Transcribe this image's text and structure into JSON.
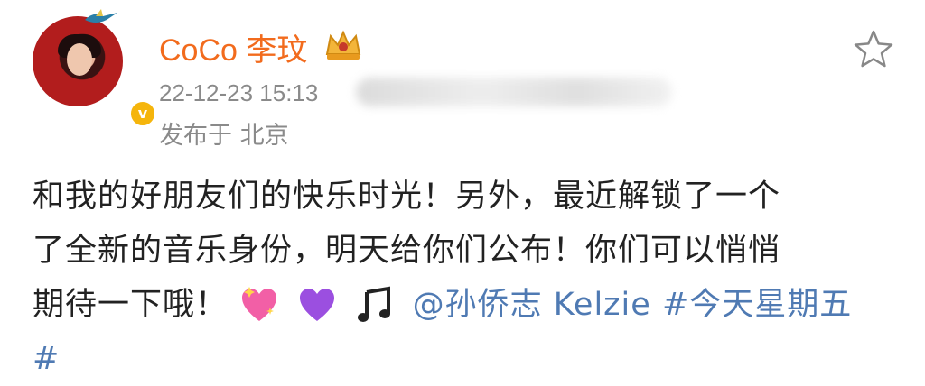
{
  "post": {
    "user_name": "CoCo 李玟",
    "timestamp": "22-12-23 15:13",
    "location": "发布于 北京",
    "verified_symbol": "v",
    "lines": [
      "和我的好朋友们的快乐时光！另外，最近解锁了一个",
      "了全新的音乐身份，明天给你们公布！你们可以悄悄",
      "期待一下哦！"
    ],
    "mention": "@孙侨志 Kelzie",
    "hashtag_part1": "#今天星期五",
    "hashtag_part2": "#"
  },
  "icons": [
    "sparkling-heart-icon",
    "purple-heart-icon",
    "music-notes-icon",
    "star-icon",
    "crown-icon"
  ],
  "colors": {
    "username": "#f26b1d",
    "link": "#4f7ab3",
    "meta": "#8a8a8a",
    "text": "#222222",
    "verified": "#f5b50c"
  }
}
